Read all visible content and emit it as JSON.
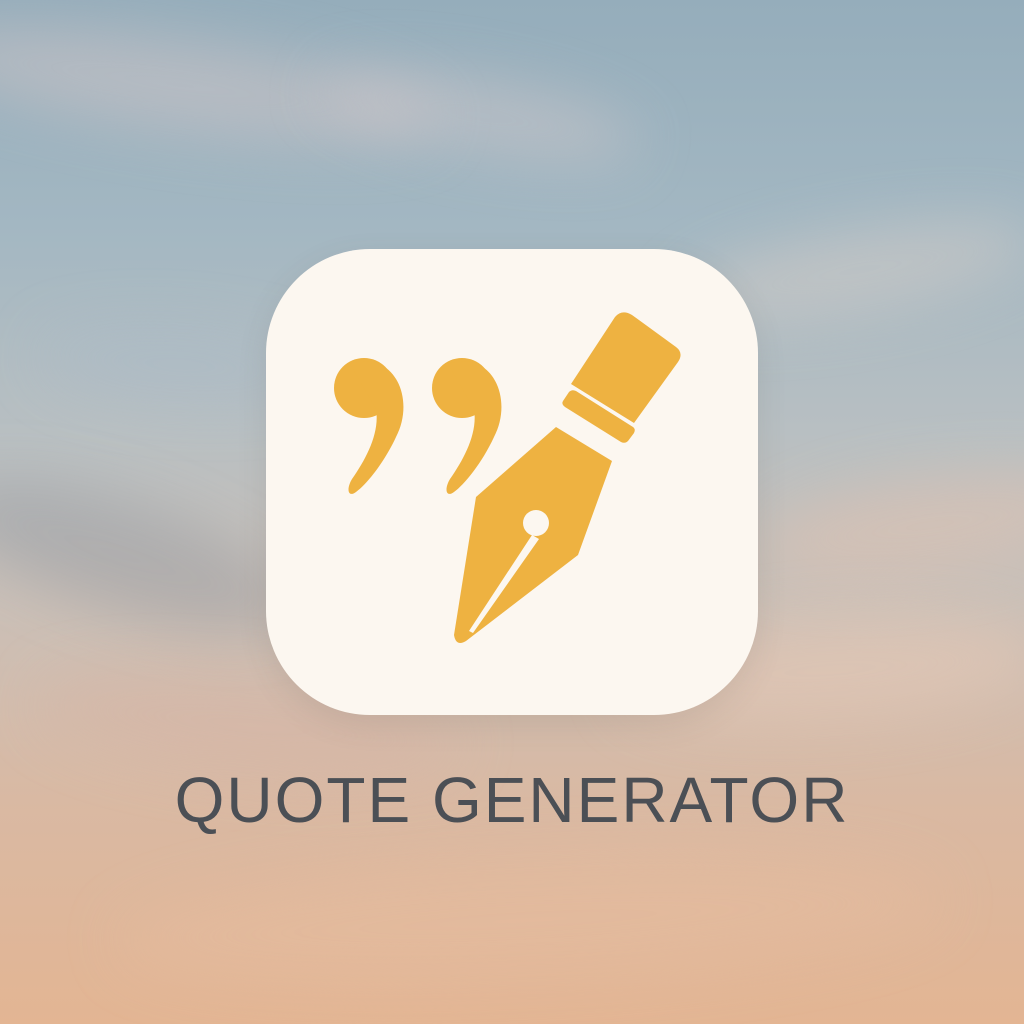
{
  "app": {
    "name": "QUOTE GENERATOR",
    "icon": "quote-pen-icon",
    "icon_background": "#fcf7f0",
    "accent_color": "#eeb241",
    "label_color": "#4b4f55"
  },
  "wallpaper": {
    "type": "sky gradient",
    "colors": [
      "#95adbb",
      "#cbbfb6",
      "#e3b593"
    ]
  }
}
